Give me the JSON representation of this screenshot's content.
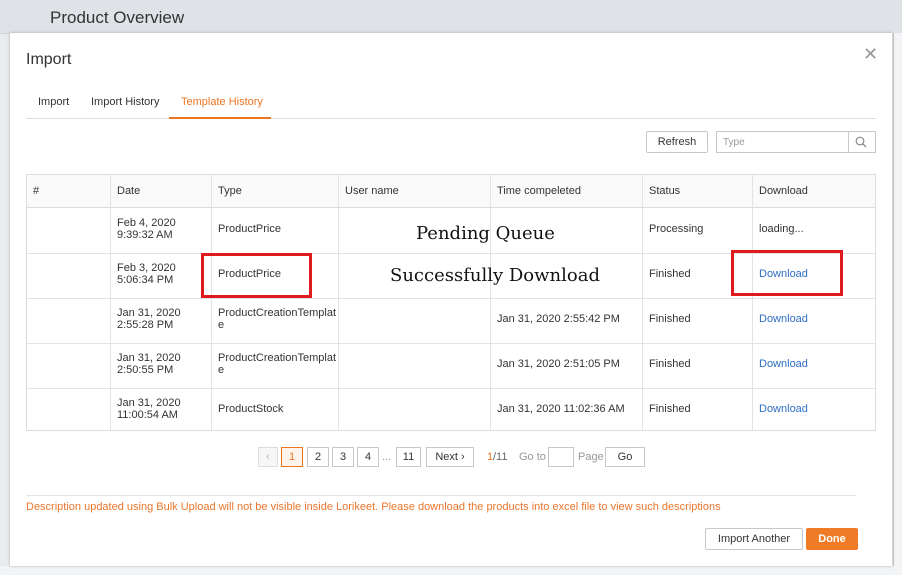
{
  "page": {
    "title": "Product Overview"
  },
  "modal": {
    "title": "Import",
    "close_glyph": "✕",
    "tabs": [
      {
        "label": "Import",
        "active": false
      },
      {
        "label": "Import History",
        "active": false
      },
      {
        "label": "Template History",
        "active": true
      }
    ],
    "toolbar": {
      "refresh_label": "Refresh",
      "search_placeholder": "Type",
      "search_icon": "search-icon"
    },
    "table": {
      "headers": [
        "#",
        "Date",
        "Type",
        "User name",
        "Time compeleted",
        "Status",
        "Download"
      ],
      "rows": [
        {
          "num": "",
          "date1": "Feb 4, 2020",
          "date2": "9:39:32 AM",
          "type1": "ProductPrice",
          "type2": "",
          "user": "",
          "completed": "",
          "status": "Processing",
          "download": "loading...",
          "download_link": false
        },
        {
          "num": "",
          "date1": "Feb 3, 2020",
          "date2": "5:06:34 PM",
          "type1": "ProductPrice",
          "type2": "",
          "user": "",
          "completed": "",
          "status": "Finished",
          "download": "Download",
          "download_link": true
        },
        {
          "num": "",
          "date1": "Jan 31, 2020",
          "date2": "2:55:28 PM",
          "type1": "ProductCreationTemplat",
          "type2": "e",
          "user": "",
          "completed": "Jan 31, 2020 2:55:42 PM",
          "status": "Finished",
          "download": "Download",
          "download_link": true
        },
        {
          "num": "",
          "date1": "Jan 31, 2020",
          "date2": "2:50:55 PM",
          "type1": "ProductCreationTemplat",
          "type2": "e",
          "user": "",
          "completed": "Jan 31, 2020 2:51:05 PM",
          "status": "Finished",
          "download": "Download",
          "download_link": true
        },
        {
          "num": "",
          "date1": "Jan 31, 2020",
          "date2": "11:00:54 AM",
          "type1": "ProductStock",
          "type2": "",
          "user": "",
          "completed": "Jan 31, 2020 11:02:36 AM",
          "status": "Finished",
          "download": "Download",
          "download_link": true
        }
      ]
    },
    "annotations": {
      "pending": "Pending Queue",
      "success": "Successfully Download",
      "highlight_color": "#e0191e"
    },
    "pagination": {
      "prev_glyph": "‹",
      "pages": [
        "1",
        "2",
        "3",
        "4"
      ],
      "ellipsis": "...",
      "last_page": "11",
      "next_label": "Next ›",
      "current": "1",
      "total": "/11",
      "goto_label": "Go to",
      "goto_value": "",
      "page_label": "Page",
      "go_button": "Go"
    },
    "notice": "Description updated using Bulk Upload will not be visible inside Lorikeet. Please download the products into excel file to view such descriptions",
    "footer": {
      "import_another": "Import Another",
      "done": "Done"
    },
    "colors": {
      "accent": "#ec7523",
      "link": "#2f6fc4",
      "done_bg": "#f07b26"
    }
  }
}
